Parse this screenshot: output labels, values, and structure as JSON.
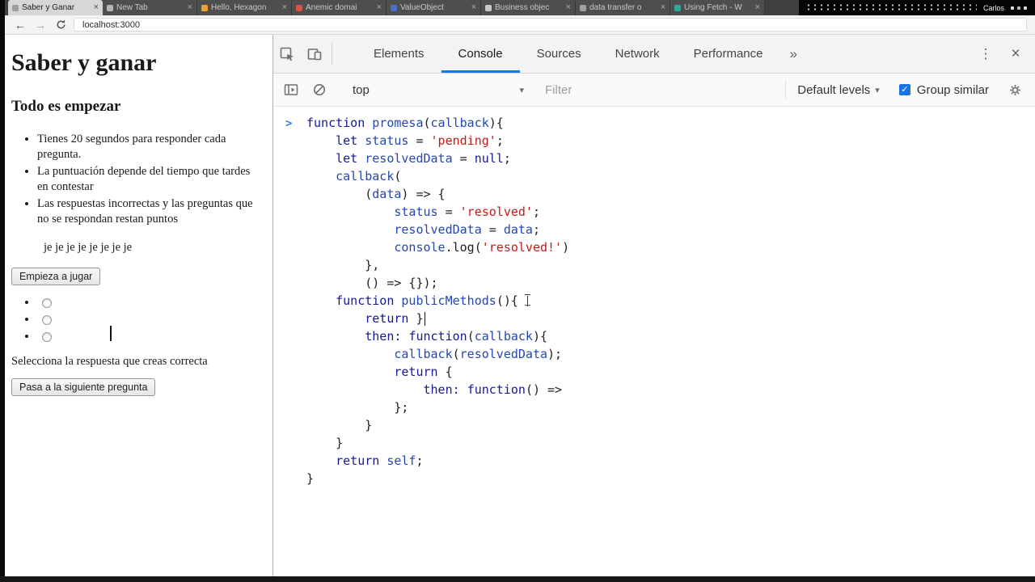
{
  "colors": {
    "accent_blue": "#1a73e8",
    "code_keyword": "#141a94",
    "code_variable": "#2547b2",
    "code_string": "#c41a16",
    "code_plain": "#202124",
    "console_prompt_blue": "#3b7ef0",
    "tab_bar_bg": "#404040",
    "active_tab_bg": "#d7d7d7"
  },
  "system": {
    "username": "Carlos"
  },
  "browser": {
    "url": "localhost:3000",
    "close_glyph": "×",
    "tabs": [
      {
        "title": "Saber y Ganar",
        "active": true,
        "favicon_color": "#9e9e9e"
      },
      {
        "title": "New Tab",
        "active": false,
        "favicon_color": "#b5b5b5"
      },
      {
        "title": "Hello, Hexagon",
        "active": false,
        "favicon_color": "#f0a030"
      },
      {
        "title": "Anemic domai",
        "active": false,
        "favicon_color": "#e05040"
      },
      {
        "title": "ValueObject",
        "active": false,
        "favicon_color": "#4a70c8"
      },
      {
        "title": "Business objec",
        "active": false,
        "favicon_color": "#c8c8c8"
      },
      {
        "title": "data transfer o",
        "active": false,
        "favicon_color": "#a0a0a0"
      },
      {
        "title": "Using Fetch - W",
        "active": false,
        "favicon_color": "#30a8a0"
      }
    ]
  },
  "page": {
    "title": "Saber y ganar",
    "subtitle": "Todo es empezar",
    "rules": [
      "Tienes 20 segundos para responder cada pregunta.",
      "La puntuación depende del tiempo que tardes en contestar",
      "Las respuestas incorrectas y las preguntas que no se respondan restan puntos"
    ],
    "joke_line": "je je je je je je je je",
    "start_button": "Empieza a jugar",
    "answer_options": [
      {
        "label": ""
      },
      {
        "label": ""
      },
      {
        "label": ""
      }
    ],
    "hint": "Selecciona la respuesta que creas correcta",
    "next_button": "Pasa a la siguiente pregunta"
  },
  "devtools": {
    "tabs": [
      {
        "label": "Elements",
        "active": false
      },
      {
        "label": "Console",
        "active": true
      },
      {
        "label": "Sources",
        "active": false
      },
      {
        "label": "Network",
        "active": false
      },
      {
        "label": "Performance",
        "active": false
      }
    ],
    "more_tabs_glyph": "»",
    "toolbar": {
      "context_selector": "top",
      "filter_placeholder": "Filter",
      "levels_label": "Default levels",
      "group_similar_label": "Group similar",
      "group_similar_checked": true
    },
    "console": {
      "prompt_glyph": ">",
      "lines": [
        [
          {
            "c": "k",
            "t": "function"
          },
          {
            "c": "p",
            "t": " "
          },
          {
            "c": "v",
            "t": "promesa"
          },
          {
            "c": "p",
            "t": "("
          },
          {
            "c": "v",
            "t": "callback"
          },
          {
            "c": "p",
            "t": "){"
          }
        ],
        [
          {
            "c": "p",
            "t": "    "
          },
          {
            "c": "k",
            "t": "let"
          },
          {
            "c": "p",
            "t": " "
          },
          {
            "c": "v",
            "t": "status"
          },
          {
            "c": "p",
            "t": " = "
          },
          {
            "c": "s",
            "t": "'pending'"
          },
          {
            "c": "p",
            "t": ";"
          }
        ],
        [
          {
            "c": "p",
            "t": "    "
          },
          {
            "c": "k",
            "t": "let"
          },
          {
            "c": "p",
            "t": " "
          },
          {
            "c": "v",
            "t": "resolvedData"
          },
          {
            "c": "p",
            "t": " = "
          },
          {
            "c": "a",
            "t": "null"
          },
          {
            "c": "p",
            "t": ";"
          }
        ],
        [
          {
            "c": "p",
            "t": "    "
          },
          {
            "c": "v",
            "t": "callback"
          },
          {
            "c": "p",
            "t": "("
          }
        ],
        [
          {
            "c": "p",
            "t": "        ("
          },
          {
            "c": "v",
            "t": "data"
          },
          {
            "c": "p",
            "t": ") => {"
          }
        ],
        [
          {
            "c": "p",
            "t": "            "
          },
          {
            "c": "v",
            "t": "status"
          },
          {
            "c": "p",
            "t": " = "
          },
          {
            "c": "s",
            "t": "'resolved'"
          },
          {
            "c": "p",
            "t": ";"
          }
        ],
        [
          {
            "c": "p",
            "t": "            "
          },
          {
            "c": "v",
            "t": "resolvedData"
          },
          {
            "c": "p",
            "t": " = "
          },
          {
            "c": "v",
            "t": "data"
          },
          {
            "c": "p",
            "t": ";"
          }
        ],
        [
          {
            "c": "p",
            "t": "            "
          },
          {
            "c": "v",
            "t": "console"
          },
          {
            "c": "p",
            "t": ".log("
          },
          {
            "c": "s",
            "t": "'resolved!'"
          },
          {
            "c": "p",
            "t": ")"
          }
        ],
        [
          {
            "c": "p",
            "t": "        },"
          }
        ],
        [
          {
            "c": "p",
            "t": "        () => {});"
          }
        ],
        [
          {
            "c": "p",
            "t": "    "
          },
          {
            "c": "k",
            "t": "function"
          },
          {
            "c": "p",
            "t": " "
          },
          {
            "c": "v",
            "t": "publicMethods"
          },
          {
            "c": "p",
            "t": "(){"
          },
          {
            "c": "ibeam",
            "t": ""
          }
        ],
        [
          {
            "c": "p",
            "t": "        "
          },
          {
            "c": "k",
            "t": "return"
          },
          {
            "c": "p",
            "t": " }"
          },
          {
            "c": "caret",
            "t": ""
          }
        ],
        [
          {
            "c": "p",
            "t": "        "
          },
          {
            "c": "pr",
            "t": "then:"
          },
          {
            "c": "p",
            "t": " "
          },
          {
            "c": "k",
            "t": "function"
          },
          {
            "c": "p",
            "t": "("
          },
          {
            "c": "v",
            "t": "callback"
          },
          {
            "c": "p",
            "t": "){"
          }
        ],
        [
          {
            "c": "p",
            "t": "            "
          },
          {
            "c": "v",
            "t": "callback"
          },
          {
            "c": "p",
            "t": "("
          },
          {
            "c": "v",
            "t": "resolvedData"
          },
          {
            "c": "p",
            "t": ");"
          }
        ],
        [
          {
            "c": "p",
            "t": "            "
          },
          {
            "c": "k",
            "t": "return"
          },
          {
            "c": "p",
            "t": " {"
          }
        ],
        [
          {
            "c": "p",
            "t": "                "
          },
          {
            "c": "pr",
            "t": "then:"
          },
          {
            "c": "p",
            "t": " "
          },
          {
            "c": "k",
            "t": "function"
          },
          {
            "c": "p",
            "t": "() =>"
          }
        ],
        [
          {
            "c": "p",
            "t": "            };"
          }
        ],
        [
          {
            "c": "p",
            "t": "        }"
          }
        ],
        [
          {
            "c": "p",
            "t": "    }"
          }
        ],
        [
          {
            "c": "p",
            "t": "    "
          },
          {
            "c": "k",
            "t": "return"
          },
          {
            "c": "p",
            "t": " "
          },
          {
            "c": "v",
            "t": "self"
          },
          {
            "c": "p",
            "t": ";"
          }
        ],
        [
          {
            "c": "p",
            "t": "}"
          }
        ]
      ]
    }
  }
}
